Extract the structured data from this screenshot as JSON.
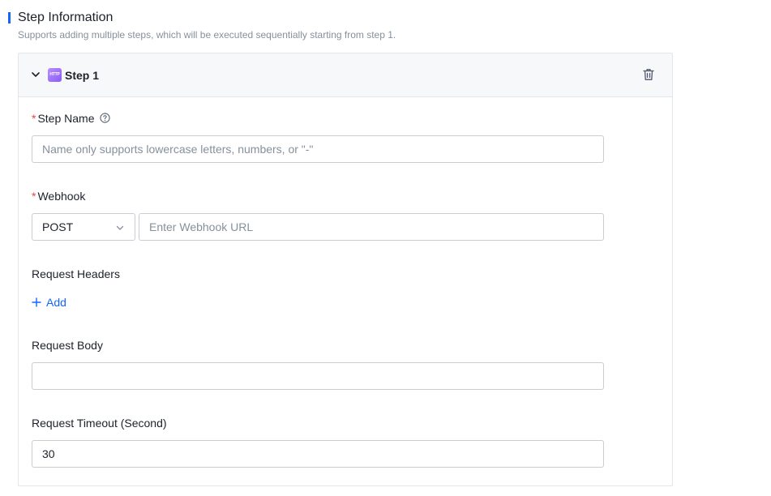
{
  "section": {
    "title": "Step Information",
    "description": "Supports adding multiple steps, which will be executed sequentially starting from step 1."
  },
  "step": {
    "badge_text": "HTTP",
    "title": "Step 1",
    "step_name": {
      "label": "Step Name",
      "required_mark": "*",
      "placeholder": "Name only supports lowercase letters, numbers, or \"-\"",
      "value": ""
    },
    "webhook": {
      "label": "Webhook",
      "required_mark": "*",
      "method": "POST",
      "url_placeholder": "Enter Webhook URL",
      "url_value": ""
    },
    "request_headers": {
      "label": "Request Headers",
      "add_label": "Add"
    },
    "request_body": {
      "label": "Request Body",
      "value": ""
    },
    "request_timeout": {
      "label": "Request Timeout (Second)",
      "value": "30"
    }
  },
  "icons": {
    "collapse": "chevron-down-icon",
    "delete": "trash-icon",
    "help": "question-circle-icon",
    "select": "chevron-down-icon",
    "add": "plus-icon"
  },
  "colors": {
    "accent": "#1664ff",
    "required": "#f53f3f",
    "badge": "#8a5cf6"
  }
}
